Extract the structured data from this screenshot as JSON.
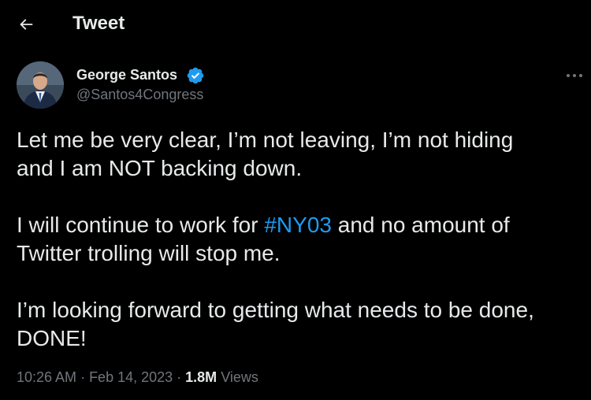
{
  "header": {
    "title": "Tweet",
    "back_icon": "arrow-left-icon"
  },
  "author": {
    "name": "George Santos",
    "handle": "@Santos4Congress",
    "verified_color": "#1d9bf0"
  },
  "tweet": {
    "p1": "Let me be very clear, I’m not leaving, I’m not hiding\nand I am NOT backing down.",
    "p2_before": "I will continue to work for ",
    "hashtag": "#NY03",
    "p2_after": " and no amount of\nTwitter trolling will stop me.",
    "p3": "I’m looking forward to getting what needs to be done,\nDONE!"
  },
  "meta": {
    "time": "10:26 AM",
    "separator": " · ",
    "date": "Feb 14, 2023",
    "views_count": "1.8M",
    "views_label": " Views"
  },
  "colors": {
    "background": "#000000",
    "text": "#e7e9ea",
    "secondary": "#71767b",
    "link": "#1d9bf0"
  }
}
